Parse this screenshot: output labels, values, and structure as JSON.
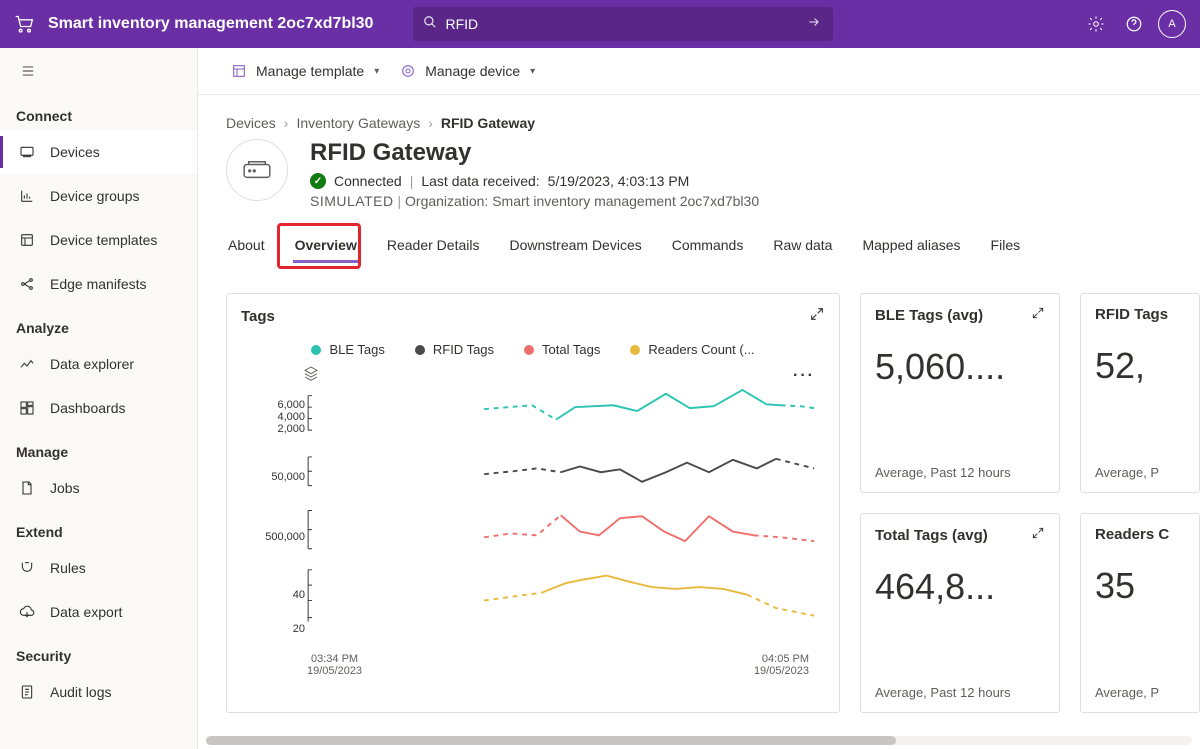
{
  "header": {
    "app_title": "Smart inventory management 2oc7xd7bl30",
    "search_value": "RFID",
    "avatar_initials": "A"
  },
  "toolbar": {
    "manage_template": "Manage template",
    "manage_device": "Manage device"
  },
  "sidebar": {
    "groups": [
      {
        "title": "Connect",
        "items": [
          {
            "key": "devices",
            "label": "Devices",
            "active": true
          },
          {
            "key": "device-groups",
            "label": "Device groups"
          },
          {
            "key": "device-templates",
            "label": "Device templates"
          },
          {
            "key": "edge-manifests",
            "label": "Edge manifests"
          }
        ]
      },
      {
        "title": "Analyze",
        "items": [
          {
            "key": "data-explorer",
            "label": "Data explorer"
          },
          {
            "key": "dashboards",
            "label": "Dashboards"
          }
        ]
      },
      {
        "title": "Manage",
        "items": [
          {
            "key": "jobs",
            "label": "Jobs"
          }
        ]
      },
      {
        "title": "Extend",
        "items": [
          {
            "key": "rules",
            "label": "Rules"
          },
          {
            "key": "data-export",
            "label": "Data export"
          }
        ]
      },
      {
        "title": "Security",
        "items": [
          {
            "key": "audit-logs",
            "label": "Audit logs"
          }
        ]
      }
    ]
  },
  "breadcrumbs": {
    "a": "Devices",
    "b": "Inventory Gateways",
    "c": "RFID Gateway"
  },
  "device": {
    "title": "RFID Gateway",
    "status": "Connected",
    "last_data_label": "Last data received:",
    "last_data_value": "5/19/2023, 4:03:13 PM",
    "simulated": "SIMULATED",
    "org_label": "Organization:",
    "org_value": "Smart inventory management 2oc7xd7bl30"
  },
  "tabs": [
    "About",
    "Overview",
    "Reader Details",
    "Downstream Devices",
    "Commands",
    "Raw data",
    "Mapped aliases",
    "Files"
  ],
  "active_tab_index": 1,
  "tags_card": {
    "title": "Tags",
    "legend": {
      "ble": "BLE Tags",
      "rfid": "RFID Tags",
      "total": "Total Tags",
      "readers": "Readers Count (..."
    },
    "xaxis": {
      "left_time": "03:34 PM",
      "left_date": "19/05/2023",
      "right_time": "04:05 PM",
      "right_date": "19/05/2023"
    }
  },
  "stat_cards": {
    "ble": {
      "title": "BLE Tags (avg)",
      "value": "5,060....",
      "sub": "Average, Past 12 hours"
    },
    "rfid": {
      "title": "RFID Tags",
      "value": "52,",
      "sub": "Average, P"
    },
    "total": {
      "title": "Total Tags (avg)",
      "value": "464,8...",
      "sub": "Average, Past 12 hours"
    },
    "readers": {
      "title": "Readers C",
      "value": "35",
      "sub": "Average, P"
    }
  },
  "chart_data": {
    "type": "line",
    "x_range": [
      "03:34 PM 19/05/2023",
      "04:05 PM 19/05/2023"
    ],
    "series": [
      {
        "name": "BLE Tags",
        "y_ticks": [
          2000,
          4000,
          6000
        ],
        "approx_values": [
          4800,
          5000,
          5200,
          3800,
          5200,
          5200,
          5300,
          4800,
          6500,
          5000,
          5400,
          6800,
          5600,
          5300,
          5200,
          5100
        ]
      },
      {
        "name": "RFID Tags",
        "y_ticks": [
          50000
        ],
        "approx_values": [
          48000,
          50000,
          52000,
          50000,
          54000,
          51000,
          52000,
          45000,
          50000,
          55000,
          50000,
          56000,
          52000,
          57000,
          55000,
          52000
        ]
      },
      {
        "name": "Total Tags",
        "y_ticks": [
          500000
        ],
        "approx_values": [
          430000,
          450000,
          440000,
          540000,
          470000,
          450000,
          530000,
          540000,
          470000,
          420000,
          540000,
          470000,
          450000,
          440000,
          430000,
          420000
        ]
      },
      {
        "name": "Readers Count",
        "y_ticks": [
          20,
          40
        ],
        "approx_values": [
          30,
          32,
          34,
          38,
          40,
          42,
          40,
          38,
          36,
          35,
          36,
          35,
          34,
          30,
          26,
          24
        ]
      }
    ],
    "note": "First ~4 points of each series are projected (dashed), rest solid."
  }
}
